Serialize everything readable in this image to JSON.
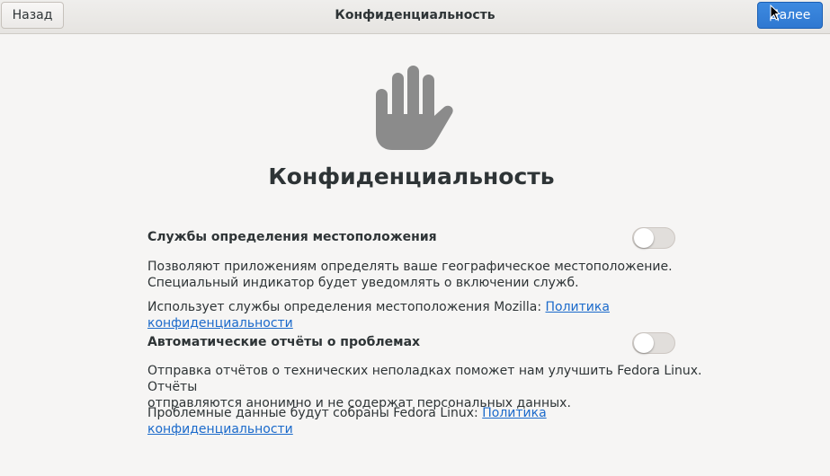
{
  "header": {
    "back_label": "Назад",
    "title": "Конфиденциальность",
    "next_label": "Далее"
  },
  "main": {
    "heading": "Конфиденциальность",
    "location": {
      "title": "Службы определения местоположения",
      "description_line1": "Позволяют приложениям определять ваше географическое местоположение.",
      "description_line2": "Специальный индикатор будет уведомлять о включении служб.",
      "provider_text": "Использует службы определения местоположения Mozilla: ",
      "policy_link": "Политика конфиденциальности",
      "enabled": false
    },
    "reports": {
      "title": "Автоматические отчёты о проблемах",
      "description_line1": "Отправка отчётов о технических неполадках поможет нам улучшить Fedora Linux. Отчёты",
      "description_line2": "отправляются анонимно и не содержат персональных данных.",
      "provider_text": "Проблемные данные будут собраны Fedora Linux: ",
      "policy_link": "Политика конфиденциальности",
      "enabled": false
    }
  },
  "icons": {
    "hero": "hand-stop-icon",
    "pointer": "mouse-pointer-icon"
  },
  "colors": {
    "accent": "#3584e4",
    "link": "#1b6acb",
    "background": "#f6f5f4",
    "icon_gray": "#8b8b8b"
  }
}
